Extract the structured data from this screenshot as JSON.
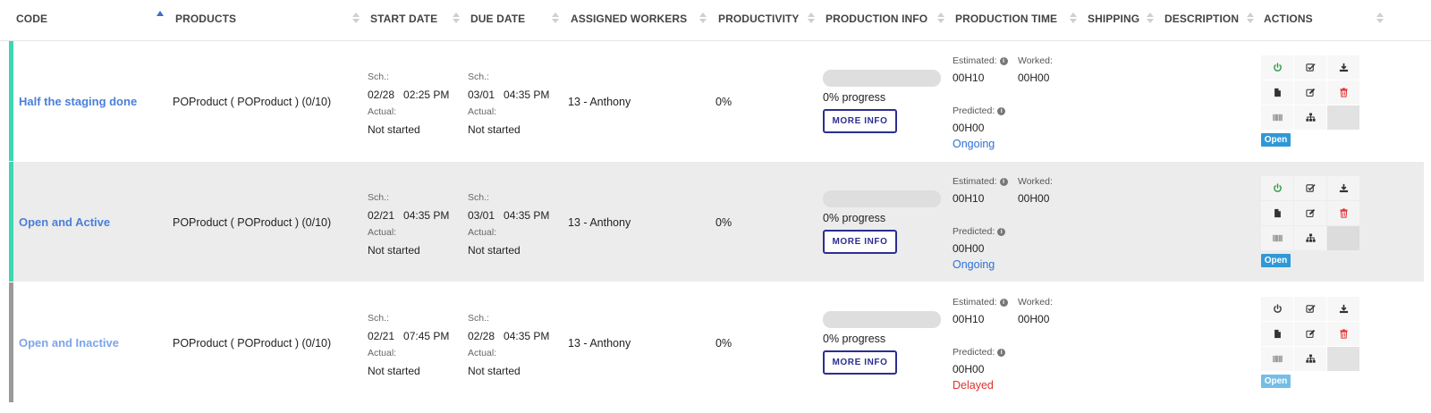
{
  "table": {
    "columns": [
      {
        "label": "CODE"
      },
      {
        "label": "PRODUCTS"
      },
      {
        "label": "START DATE"
      },
      {
        "label": "DUE DATE"
      },
      {
        "label": "ASSIGNED WORKERS"
      },
      {
        "label": "PRODUCTIVITY"
      },
      {
        "label": "PRODUCTION INFO"
      },
      {
        "label": "PRODUCTION TIME"
      },
      {
        "label": "SHIPPING"
      },
      {
        "label": "DESCRIPTION"
      },
      {
        "label": "ACTIONS"
      }
    ],
    "sorted_column": "CODE",
    "sort_direction": "ascending",
    "rows": [
      {
        "code": "Half the staging done",
        "bar_color": "#3ed6b3",
        "product": "POProduct ( POProduct ) (0/10)",
        "start": {
          "sch_label": "Sch.:",
          "sch_date": "02/28",
          "sch_time": "02:25 PM",
          "actual_label": "Actual:",
          "actual_value": "Not started"
        },
        "due": {
          "sch_label": "Sch.:",
          "sch_date": "03/01",
          "sch_time": "04:35 PM",
          "actual_label": "Actual:",
          "actual_value": "Not started"
        },
        "worker": "13 - Anthony",
        "productivity": "0%",
        "progress_fraction": 0,
        "progress_text": "0% progress",
        "more_info_label": "MORE INFO",
        "estimated_label": "Estimated:",
        "estimated_value": "00H10",
        "worked_label": "Worked:",
        "worked_value": "00H00",
        "predicted_label": "Predicted:",
        "predicted_value": "00H00",
        "status": "Ongoing",
        "status_color": "#2f6fd8",
        "open_label": "Open",
        "power_color": "#2a9a3a"
      },
      {
        "code": "Open and Active",
        "bar_color": "#3ed6b3",
        "product": "POProduct ( POProduct ) (0/10)",
        "start": {
          "sch_label": "Sch.:",
          "sch_date": "02/21",
          "sch_time": "04:35 PM",
          "actual_label": "Actual:",
          "actual_value": "Not started"
        },
        "due": {
          "sch_label": "Sch.:",
          "sch_date": "03/01",
          "sch_time": "04:35 PM",
          "actual_label": "Actual:",
          "actual_value": "Not started"
        },
        "worker": "13 - Anthony",
        "productivity": "0%",
        "progress_fraction": 0,
        "progress_text": "0% progress",
        "more_info_label": "MORE INFO",
        "estimated_label": "Estimated:",
        "estimated_value": "00H10",
        "worked_label": "Worked:",
        "worked_value": "00H00",
        "predicted_label": "Predicted:",
        "predicted_value": "00H00",
        "status": "Ongoing",
        "status_color": "#2f6fd8",
        "open_label": "Open",
        "power_color": "#2a9a3a"
      },
      {
        "code": "Open and Inactive",
        "bar_color": "#9a9a9a",
        "product": "POProduct ( POProduct ) (0/10)",
        "start": {
          "sch_label": "Sch.:",
          "sch_date": "02/21",
          "sch_time": "07:45 PM",
          "actual_label": "Actual:",
          "actual_value": "Not started"
        },
        "due": {
          "sch_label": "Sch.:",
          "sch_date": "02/28",
          "sch_time": "04:35 PM",
          "actual_label": "Actual:",
          "actual_value": "Not started"
        },
        "worker": "13 - Anthony",
        "productivity": "0%",
        "progress_fraction": 0,
        "progress_text": "0% progress",
        "more_info_label": "MORE INFO",
        "estimated_label": "Estimated:",
        "estimated_value": "00H10",
        "worked_label": "Worked:",
        "worked_value": "00H00",
        "predicted_label": "Predicted:",
        "predicted_value": "00H00",
        "status": "Delayed",
        "status_color": "#e03030",
        "open_label": "Open",
        "power_color": "#333333"
      }
    ]
  },
  "action_icons": [
    "power-icon",
    "check-square-icon",
    "download-icon",
    "file-icon",
    "edit-icon",
    "trash-icon",
    "barcode-icon",
    "sitemap-icon"
  ],
  "colors": {
    "link": "#4a7fd9",
    "accent_dark": "#2b2f8f",
    "open_badge": "#2f98d6",
    "danger": "#e03030"
  }
}
